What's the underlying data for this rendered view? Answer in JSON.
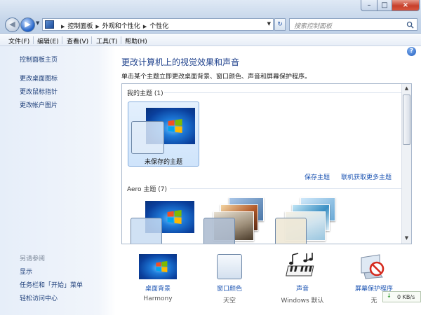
{
  "window": {
    "controls": {
      "minimize": "–",
      "maximize": "□",
      "close": "×"
    }
  },
  "address_bar": {
    "breadcrumbs": [
      "控制面板",
      "外观和个性化",
      "个性化"
    ],
    "search_placeholder": "搜索控制面板"
  },
  "menu": [
    "文件(F)",
    "编辑(E)",
    "查看(V)",
    "工具(T)",
    "帮助(H)"
  ],
  "sidebar": {
    "home": "控制面板主页",
    "links": [
      "更改桌面图标",
      "更改鼠标指针",
      "更改帐户图片"
    ],
    "see_also_title": "另请参阅",
    "see_also": [
      "显示",
      "任务栏和「开始」菜单",
      "轻松访问中心"
    ]
  },
  "main": {
    "title": "更改计算机上的视觉效果和声音",
    "subtitle": "单击某个主题立即更改桌面背景、窗口颜色、声音和屏幕保护程序。",
    "my_themes_header": "我的主题 (1)",
    "unsaved_theme_label": "未保存的主题",
    "save_theme_link": "保存主题",
    "get_more_link": "联机获取更多主题",
    "aero_header": "Aero 主题 (7)"
  },
  "quick_settings": [
    {
      "label": "桌面背景",
      "value": "Harmony"
    },
    {
      "label": "窗口颜色",
      "value": "天空"
    },
    {
      "label": "声音",
      "value": "Windows 默认"
    },
    {
      "label": "屏幕保护程序",
      "value": "无"
    }
  ],
  "tray": {
    "net_speed": "0 KB/s",
    "net_arrow": "↓"
  },
  "icons": {
    "back": "arrow-left-icon",
    "forward": "arrow-right-icon",
    "refresh": "refresh-icon",
    "search": "search-icon",
    "help": "help-icon"
  },
  "colors": {
    "title_blue": "#1c3f8b",
    "link_blue": "#1d55b3",
    "selection": "#cfe4fb"
  }
}
